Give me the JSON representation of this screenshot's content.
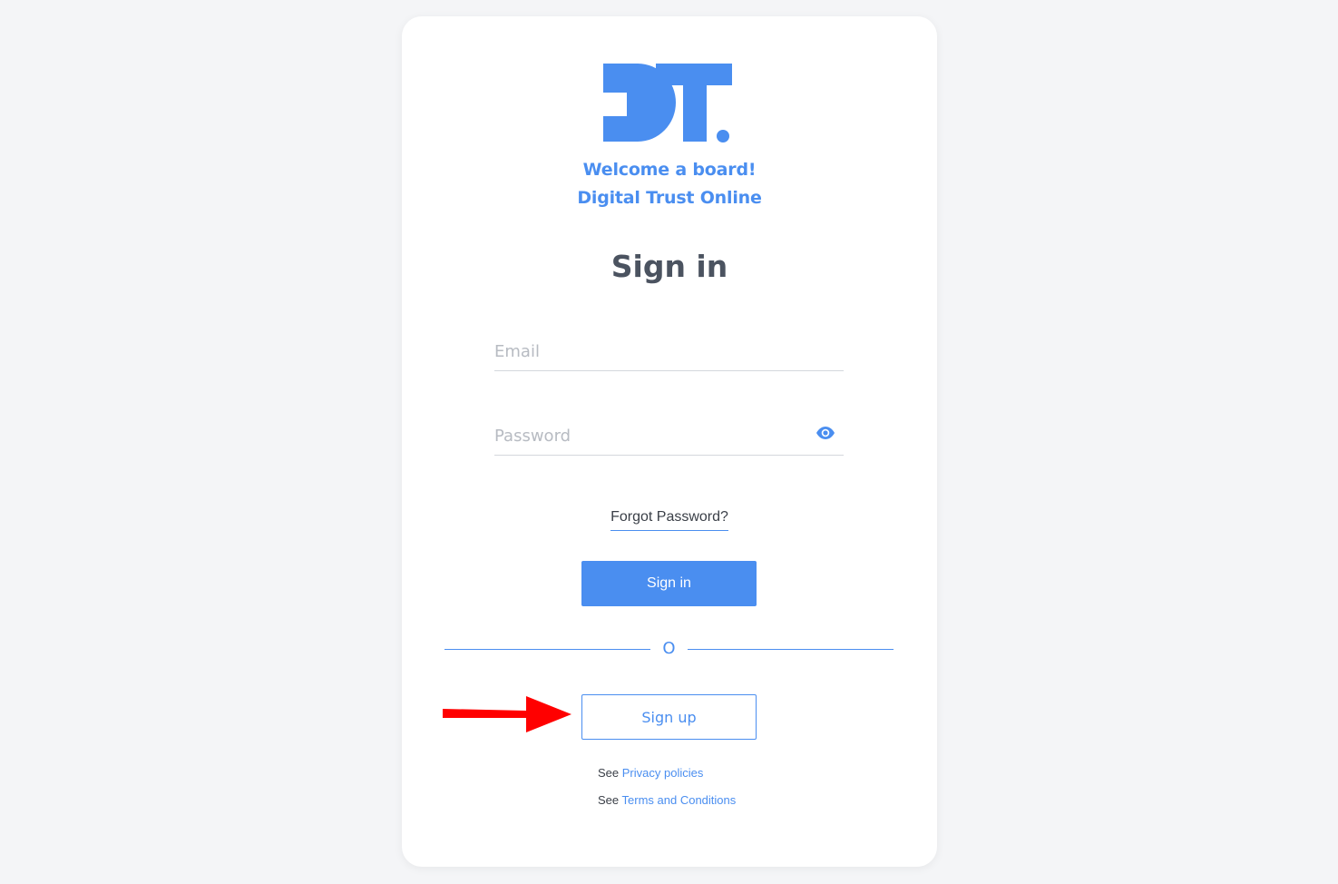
{
  "brand": {
    "logo_text": "DT.",
    "welcome_line_1": "Welcome a board!",
    "welcome_line_2": "Digital Trust Online"
  },
  "form": {
    "title": "Sign in",
    "email_placeholder": "Email",
    "password_placeholder": "Password",
    "show_password_icon": "eye-icon",
    "forgot_password": "Forgot Password?",
    "signin_button": "Sign in",
    "divider_text": "O",
    "signup_button": "Sign up"
  },
  "footer": {
    "see_1": "See",
    "privacy_link": "Privacy policies",
    "see_2": "See",
    "terms_link": "Terms and Conditions"
  },
  "annotation": {
    "arrow_color": "#ff0000",
    "arrow_target": "Sign up"
  },
  "colors": {
    "accent": "#4a8ef0",
    "background": "#f4f5f7",
    "card": "#ffffff",
    "title_text": "#4b5360"
  }
}
